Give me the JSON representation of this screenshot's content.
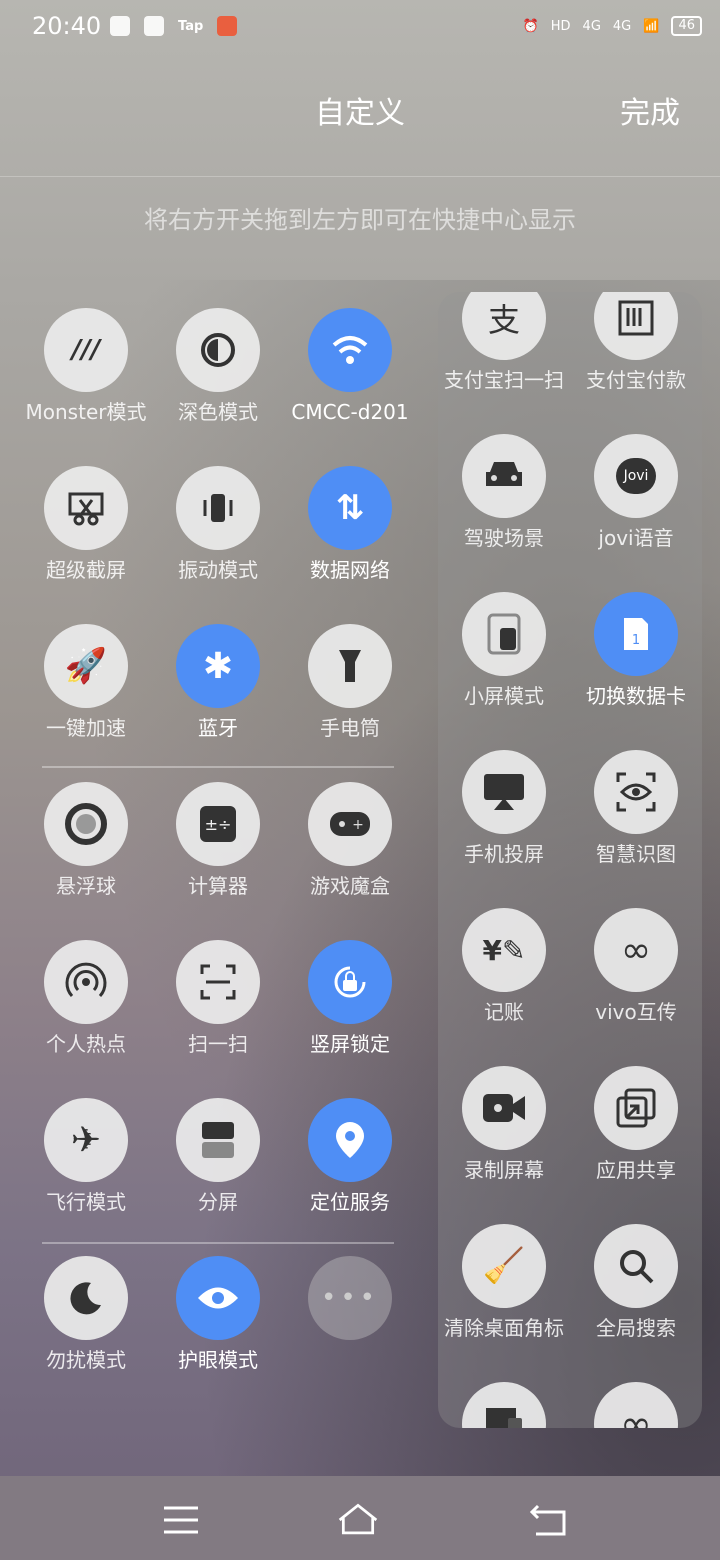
{
  "status_bar": {
    "time": "20:40",
    "tap_label": "Tap",
    "network_hd": "HD",
    "net1": "4G",
    "net2": "4G",
    "battery": "46"
  },
  "header": {
    "title": "自定义",
    "done": "完成"
  },
  "hint": "将右方开关拖到左方即可在快捷中心显示",
  "left_tiles": [
    {
      "label": "Monster模式",
      "icon": "monster-icon",
      "on": false
    },
    {
      "label": "深色模式",
      "icon": "dark-mode-icon",
      "on": false
    },
    {
      "label": "CMCC-d201",
      "icon": "wifi-icon",
      "on": true
    },
    {
      "label": "超级截屏",
      "icon": "screenshot-icon",
      "on": false
    },
    {
      "label": "振动模式",
      "icon": "vibration-icon",
      "on": false
    },
    {
      "label": "数据网络",
      "icon": "data-network-icon",
      "on": true
    },
    {
      "label": "一键加速",
      "icon": "rocket-icon",
      "on": false
    },
    {
      "label": "蓝牙",
      "icon": "bluetooth-icon",
      "on": true
    },
    {
      "label": "手电筒",
      "icon": "flashlight-icon",
      "on": false
    },
    {
      "label": "悬浮球",
      "icon": "floating-ball-icon",
      "on": false
    },
    {
      "label": "计算器",
      "icon": "calculator-icon",
      "on": false
    },
    {
      "label": "游戏魔盒",
      "icon": "gamepad-icon",
      "on": false
    },
    {
      "label": "个人热点",
      "icon": "hotspot-icon",
      "on": false
    },
    {
      "label": "扫一扫",
      "icon": "scan-icon",
      "on": false
    },
    {
      "label": "竖屏锁定",
      "icon": "rotation-lock-icon",
      "on": true
    },
    {
      "label": "飞行模式",
      "icon": "airplane-icon",
      "on": false
    },
    {
      "label": "分屏",
      "icon": "split-screen-icon",
      "on": false
    },
    {
      "label": "定位服务",
      "icon": "location-icon",
      "on": true
    },
    {
      "label": "勿扰模式",
      "icon": "moon-icon",
      "on": false
    },
    {
      "label": "护眼模式",
      "icon": "eye-icon",
      "on": true
    },
    {
      "label": "",
      "icon": "more-icon",
      "on": false
    }
  ],
  "right_tiles": [
    {
      "label": "支付宝扫一扫",
      "icon": "alipay-scan-icon"
    },
    {
      "label": "支付宝付款",
      "icon": "alipay-pay-icon"
    },
    {
      "label": "驾驶场景",
      "icon": "car-icon"
    },
    {
      "label": "jovi语音",
      "icon": "jovi-icon",
      "text": "Jovi"
    },
    {
      "label": "小屏模式",
      "icon": "small-screen-icon"
    },
    {
      "label": "切换数据卡",
      "icon": "sim-card-icon",
      "on": true
    },
    {
      "label": "手机投屏",
      "icon": "cast-icon"
    },
    {
      "label": "智慧识图",
      "icon": "image-recognition-icon"
    },
    {
      "label": "记账",
      "icon": "bookkeeping-icon"
    },
    {
      "label": "vivo互传",
      "icon": "vivo-share-icon"
    },
    {
      "label": "录制屏幕",
      "icon": "screen-record-icon"
    },
    {
      "label": "应用共享",
      "icon": "app-share-icon"
    },
    {
      "label": "清除桌面角标",
      "icon": "clear-badge-icon"
    },
    {
      "label": "全局搜索",
      "icon": "search-icon"
    },
    {
      "label": "",
      "icon": "desktop-icon"
    },
    {
      "label": "",
      "icon": "infinity-icon"
    }
  ],
  "nav": {
    "menu": "menu-icon",
    "home": "home-icon",
    "back": "back-icon"
  }
}
